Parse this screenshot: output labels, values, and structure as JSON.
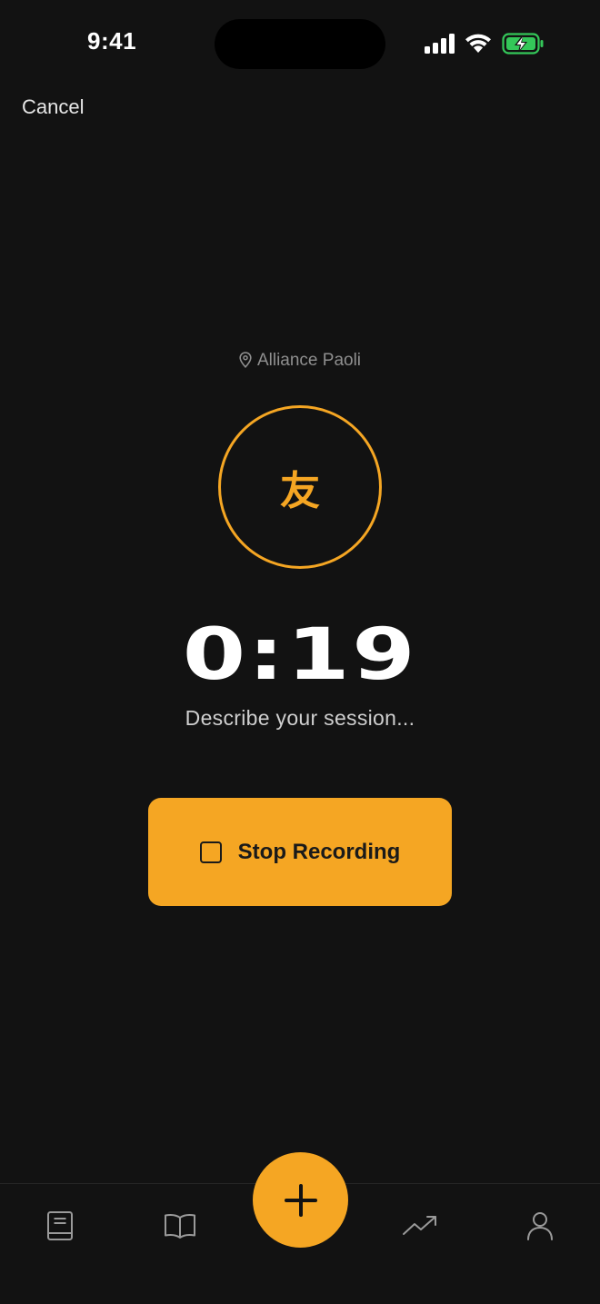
{
  "status_bar": {
    "time": "9:41",
    "icons": [
      "cellular-signal-icon",
      "wifi-icon",
      "battery-charging-icon"
    ]
  },
  "header": {
    "cancel_label": "Cancel"
  },
  "session": {
    "location": "Alliance Paoli",
    "location_icon": "map-pin-icon",
    "avatar_glyph": "友",
    "timer": "0:19",
    "prompt": "Describe your session..."
  },
  "actions": {
    "stop_label": "Stop Recording",
    "stop_icon": "stop-square-icon"
  },
  "tab_bar": {
    "items": [
      {
        "icon": "notebook-icon"
      },
      {
        "icon": "open-book-icon"
      },
      {
        "icon": "plus-icon"
      },
      {
        "icon": "trending-up-icon"
      },
      {
        "icon": "user-icon"
      }
    ]
  },
  "colors": {
    "background": "#121212",
    "accent": "#f5a623",
    "battery": "#34c759"
  }
}
